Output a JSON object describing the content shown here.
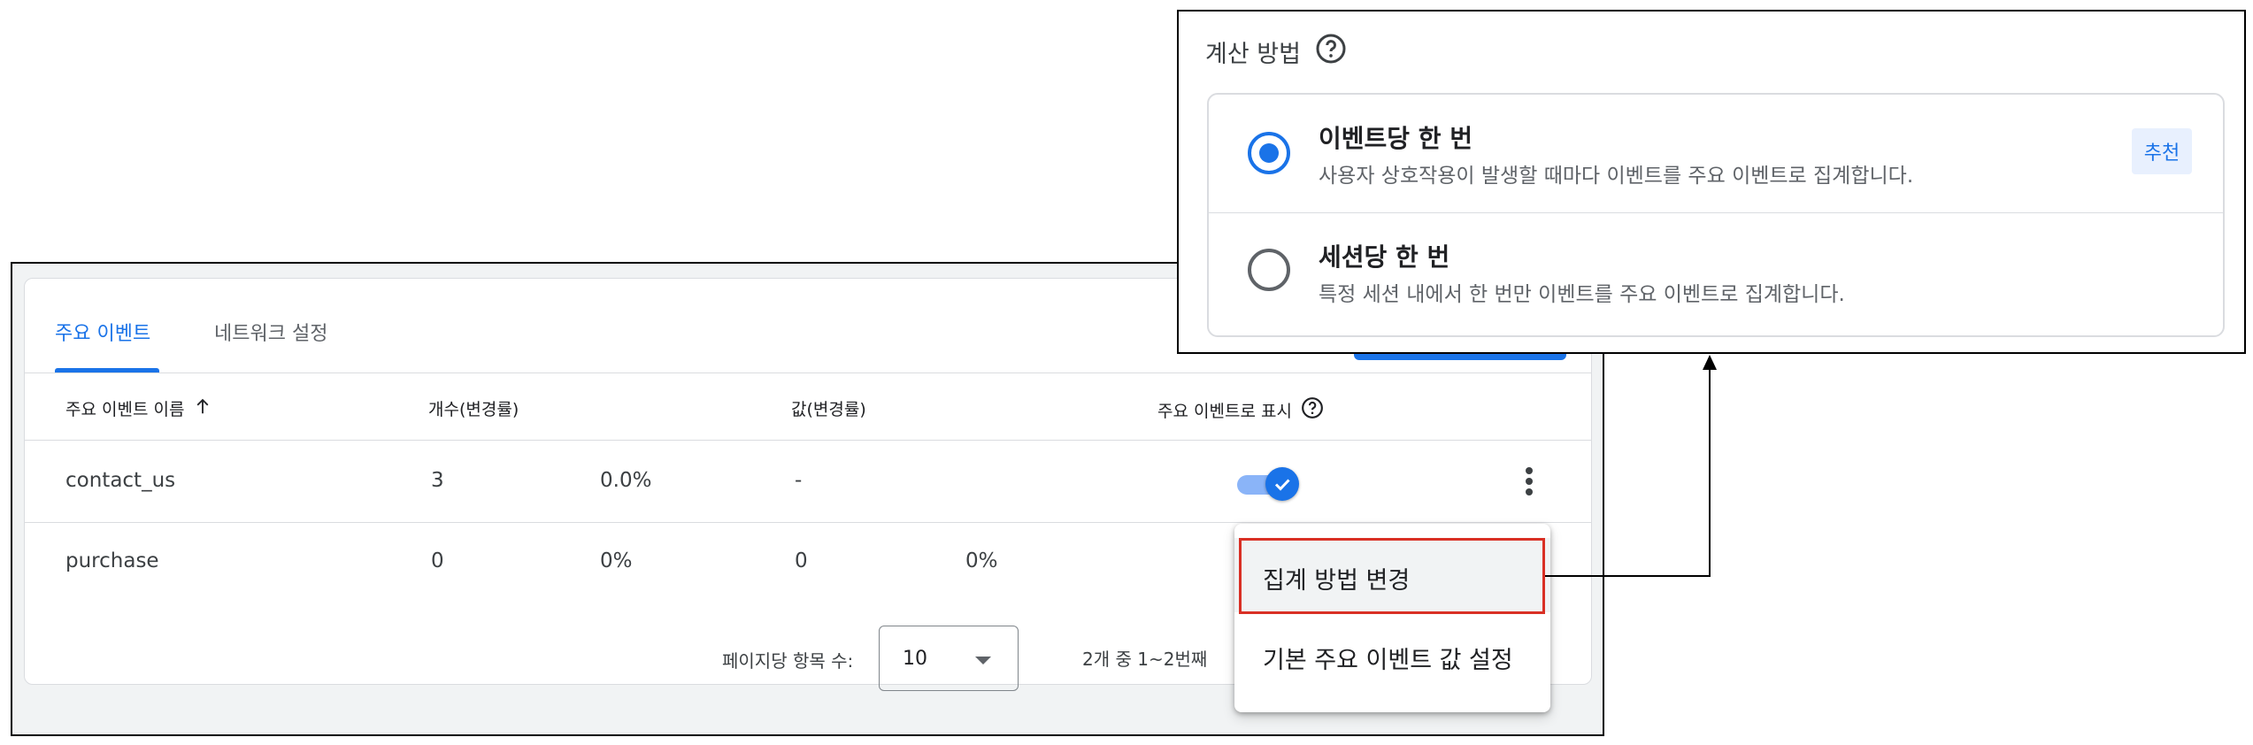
{
  "tabs": [
    {
      "label": "주요 이벤트"
    },
    {
      "label": "네트워크 설정"
    }
  ],
  "table": {
    "headers": [
      "주요 이벤트 이름",
      "개수(변경률)",
      "값(변경률)",
      "주요 이벤트로 표시"
    ],
    "rows": [
      {
        "name": "contact_us",
        "count": "3",
        "count_change": "0.0%",
        "value": "-",
        "value_change": "",
        "marked": true
      },
      {
        "name": "purchase",
        "count": "0",
        "count_change": "0%",
        "value": "0",
        "value_change": "0%",
        "marked": false
      }
    ]
  },
  "pagination": {
    "items_per_page_label": "페이지당 항목 수:",
    "items_per_page_value": "10",
    "range_text": "2개 중 1~2번째"
  },
  "context_menu": {
    "items": [
      {
        "label": "집계 방법 변경",
        "highlighted": true
      },
      {
        "label": "기본 주요 이벤트 값 설정",
        "highlighted": false
      }
    ]
  },
  "calculation_dialog": {
    "title": "계산 방법",
    "options": [
      {
        "title": "이벤트당 한 번",
        "description": "사용자 상호작용이 발생할 때마다 이벤트를 주요 이벤트로 집계합니다.",
        "badge": "추천",
        "selected": true
      },
      {
        "title": "세션당 한 번",
        "description": "특정 세션 내에서 한 번만 이벤트를 주요 이벤트로 집계합니다.",
        "selected": false
      }
    ]
  },
  "colors": {
    "accent": "#1a73e8",
    "highlight_border": "#d93025",
    "toggle_track_on": "#8ab4f8",
    "badge_bg": "#e8f0fe"
  },
  "icons": {
    "sort": "arrow-up-icon",
    "help": "help-circle-icon",
    "menu": "more-vert-icon",
    "dropdown": "caret-down-icon",
    "check": "check-icon"
  }
}
